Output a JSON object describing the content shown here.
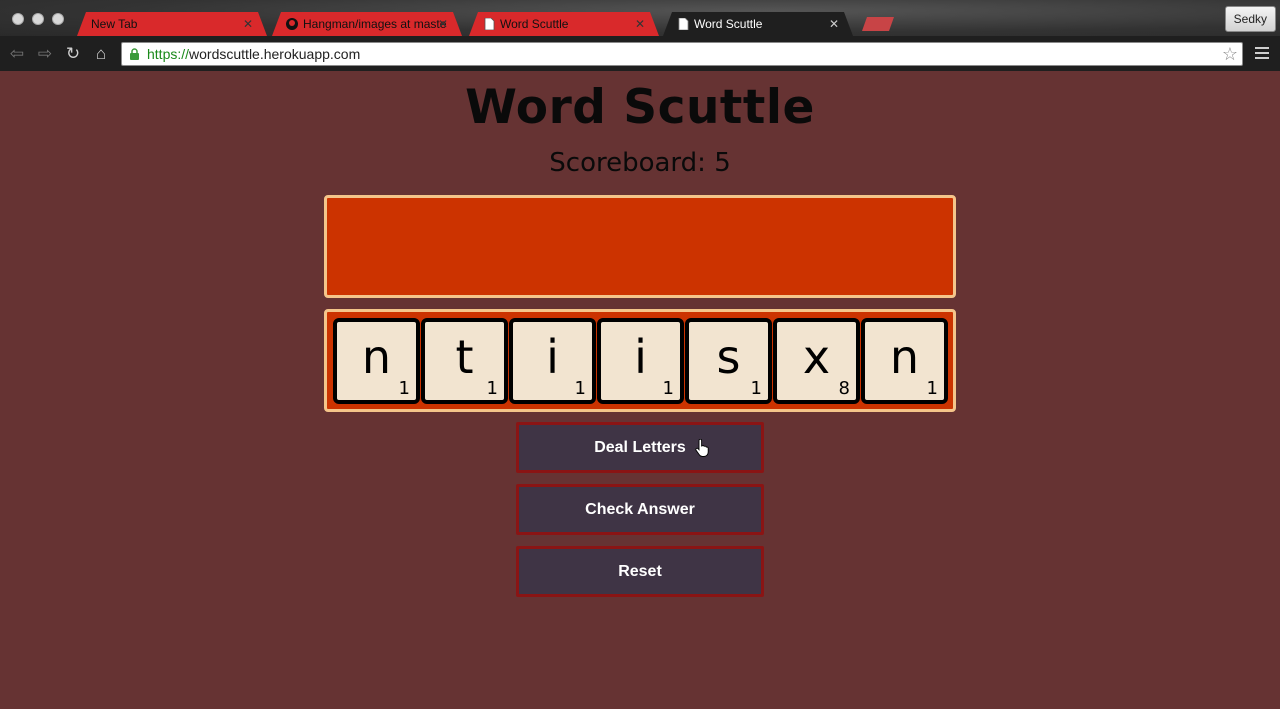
{
  "browser": {
    "tabs": [
      {
        "title": "New Tab",
        "icon": "none"
      },
      {
        "title": "Hangman/images at maste",
        "icon": "github-icon"
      },
      {
        "title": "Word Scuttle",
        "icon": "page-icon"
      },
      {
        "title": "Word Scuttle",
        "icon": "page-icon",
        "active": true
      }
    ],
    "profile_name": "Sedky",
    "url_scheme": "https://",
    "url_host": "wordscuttle.herokuapp.com"
  },
  "page": {
    "title": "Word Scuttle",
    "scoreboard": "Scoreboard: 5",
    "tiles": [
      {
        "letter": "n",
        "points": "1"
      },
      {
        "letter": "t",
        "points": "1"
      },
      {
        "letter": "i",
        "points": "1"
      },
      {
        "letter": "i",
        "points": "1"
      },
      {
        "letter": "s",
        "points": "1"
      },
      {
        "letter": "x",
        "points": "8"
      },
      {
        "letter": "n",
        "points": "1"
      }
    ],
    "buttons": {
      "deal": "Deal Letters",
      "check": "Check Answer",
      "reset": "Reset"
    }
  },
  "colors": {
    "page_bg": "#663333",
    "board_fill": "#cc3300",
    "board_border": "#f5c58a",
    "tile_fill": "#f2e4d0",
    "button_fill": "#3f3445",
    "button_border": "#8a1414"
  }
}
